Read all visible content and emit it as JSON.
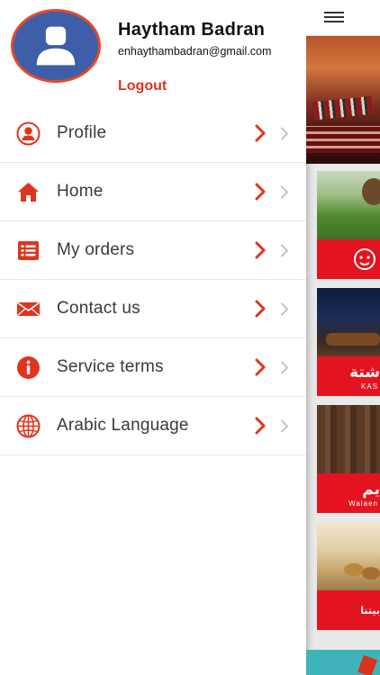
{
  "user": {
    "name": "Haytham Badran",
    "email": "enhaythambadran@gmail.com",
    "logout_label": "Logout"
  },
  "menu": {
    "items": [
      {
        "label": "Profile",
        "icon": "person-icon"
      },
      {
        "label": "Home",
        "icon": "home-icon"
      },
      {
        "label": "My orders",
        "icon": "list-icon"
      },
      {
        "label": "Contact us",
        "icon": "mail-icon"
      },
      {
        "label": "Service terms",
        "icon": "info-icon"
      },
      {
        "label": "Arabic Language",
        "icon": "globe-icon"
      }
    ]
  },
  "background": {
    "cards": [
      {
        "brand": ""
      },
      {
        "brand": "شتة",
        "sub": "KAS"
      },
      {
        "brand": "يم",
        "sub": "Walaen"
      },
      {
        "brand": "بيتنا"
      }
    ]
  },
  "colors": {
    "accent": "#e0341f",
    "avatar_bg": "#3e5ea9",
    "text": "#3a3a3a",
    "brand_red": "#e3141f"
  }
}
